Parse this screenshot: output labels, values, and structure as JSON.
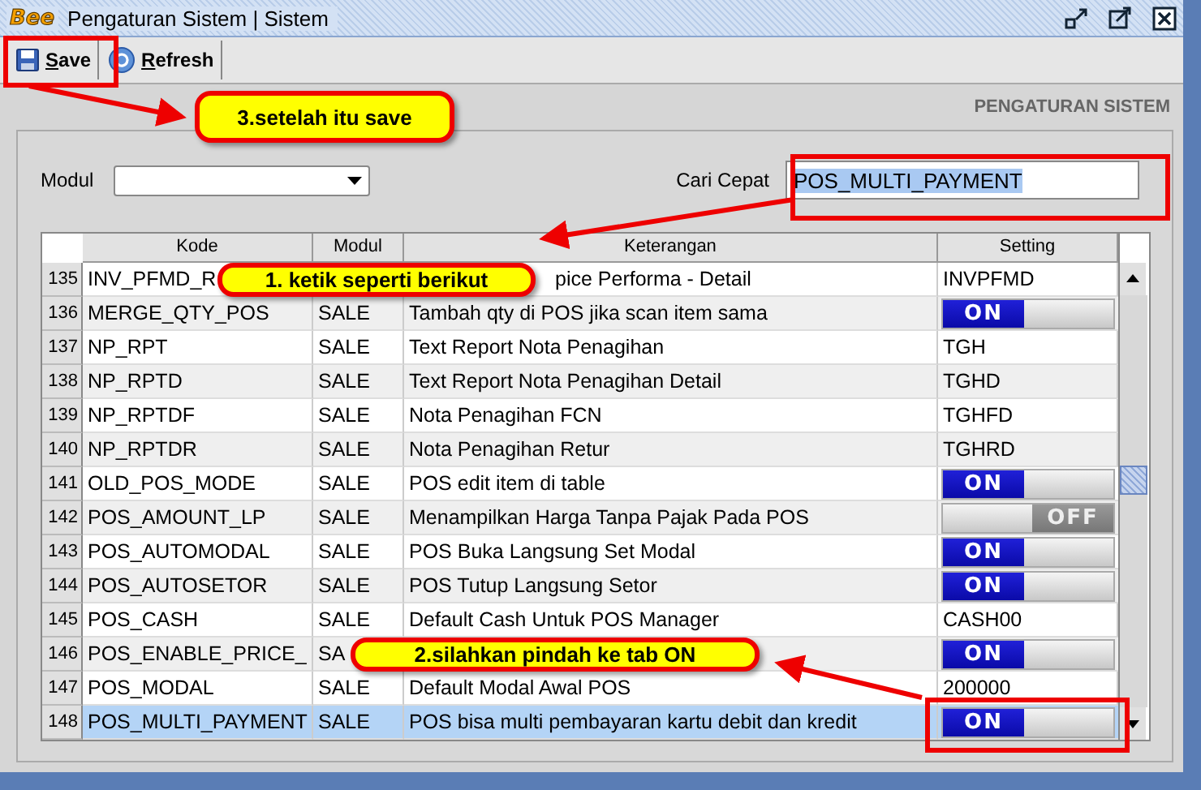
{
  "window": {
    "logo": "Bee",
    "title": "Pengaturan Sistem | Sistem"
  },
  "toolbar": [
    {
      "label": "Save",
      "kind": "save"
    },
    {
      "label": "Refresh",
      "kind": "refresh"
    }
  ],
  "heading": "PENGATURAN SISTEM",
  "filter": {
    "modul_label": "Modul",
    "search_label": "Cari Cepat",
    "search_value": "POS_MULTI_PAYMENT"
  },
  "table": {
    "columns": [
      "Kode",
      "Modul",
      "Keterangan",
      "Setting"
    ],
    "rows": [
      {
        "no": "135",
        "kode": "INV_PFMD_R",
        "keterangan": "pice Performa - Detail",
        "setting": {
          "kind": "text",
          "value": "INVPFMD"
        },
        "selected": false
      },
      {
        "no": "136",
        "kode": "MERGE_QTY_POS",
        "modul": "SALE",
        "keterangan": "Tambah qty di POS jika scan item sama",
        "setting": {
          "kind": "toggle",
          "on": true,
          "label": "ON"
        },
        "selected": false
      },
      {
        "no": "137",
        "kode": "NP_RPT",
        "modul": "SALE",
        "keterangan": "Text Report Nota Penagihan",
        "setting": {
          "kind": "text",
          "value": "TGH"
        },
        "selected": false
      },
      {
        "no": "138",
        "kode": "NP_RPTD",
        "modul": "SALE",
        "keterangan": "Text Report Nota Penagihan Detail",
        "setting": {
          "kind": "text",
          "value": "TGHD"
        },
        "selected": false
      },
      {
        "no": "139",
        "kode": "NP_RPTDF",
        "modul": "SALE",
        "keterangan": "Nota Penagihan FCN",
        "setting": {
          "kind": "text",
          "value": "TGHFD"
        },
        "selected": false
      },
      {
        "no": "140",
        "kode": "NP_RPTDR",
        "modul": "SALE",
        "keterangan": "Nota Penagihan Retur",
        "setting": {
          "kind": "text",
          "value": "TGHRD"
        },
        "selected": false
      },
      {
        "no": "141",
        "kode": "OLD_POS_MODE",
        "modul": "SALE",
        "keterangan": "POS edit item di table",
        "setting": {
          "kind": "toggle",
          "on": true,
          "label": "ON"
        },
        "selected": false
      },
      {
        "no": "142",
        "kode": "POS_AMOUNT_LP",
        "modul": "SALE",
        "keterangan": "Menampilkan Harga Tanpa Pajak Pada POS",
        "setting": {
          "kind": "toggle",
          "on": false,
          "label": "OFF"
        },
        "selected": false
      },
      {
        "no": "143",
        "kode": "POS_AUTOMODAL",
        "modul": "SALE",
        "keterangan": "POS Buka Langsung Set Modal",
        "setting": {
          "kind": "toggle",
          "on": true,
          "label": "ON"
        },
        "selected": false
      },
      {
        "no": "144",
        "kode": "POS_AUTOSETOR",
        "modul": "SALE",
        "keterangan": "POS Tutup Langsung Setor",
        "setting": {
          "kind": "toggle",
          "on": true,
          "label": "ON"
        },
        "selected": false
      },
      {
        "no": "145",
        "kode": "POS_CASH",
        "modul": "SALE",
        "keterangan": "Default Cash Untuk POS Manager",
        "setting": {
          "kind": "text",
          "value": "CASH00"
        },
        "selected": false
      },
      {
        "no": "146",
        "kode": "POS_ENABLE_PRICE_",
        "modul": "SA",
        "setting": {
          "kind": "toggle",
          "on": true,
          "label": "ON"
        },
        "selected": false
      },
      {
        "no": "147",
        "kode": "POS_MODAL",
        "modul": "SALE",
        "keterangan": "Default Modal Awal POS",
        "setting": {
          "kind": "text",
          "value": "200000"
        },
        "selected": false
      },
      {
        "no": "148",
        "kode": "POS_MULTI_PAYMENT",
        "modul": "SALE",
        "keterangan": "POS bisa multi pembayaran kartu debit dan kredit",
        "setting": {
          "kind": "toggle",
          "on": true,
          "label": "ON"
        },
        "selected": true
      }
    ]
  },
  "annotations": [
    {
      "text": "3.setelah itu save"
    },
    {
      "text": "1. ketik seperti berikut"
    },
    {
      "text": "2.silahkan pindah ke tab ON"
    }
  ]
}
